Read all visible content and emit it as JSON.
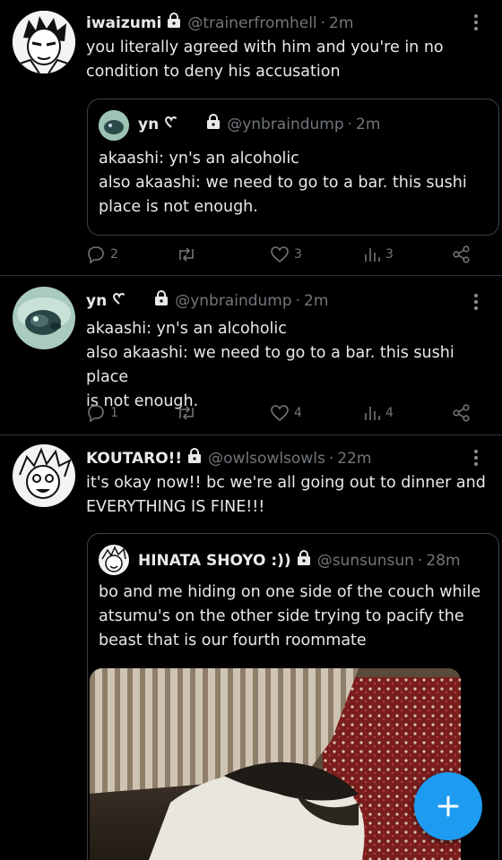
{
  "tweets": [
    {
      "name": "iwaizumi",
      "handle": "@trainerfromhell",
      "time": "2m",
      "text": "you literally agreed with him and you're in no\ncondition to deny his accusation",
      "quote": {
        "name": "yn",
        "handle": "@ynbraindump",
        "time": "2m",
        "text": "akaashi: yn's an alcoholic\nalso akaashi: we need to go to a bar. this sushi\nplace is not enough."
      },
      "actions": {
        "replies": "2",
        "likes": "3",
        "views": "3"
      }
    },
    {
      "name": "yn",
      "handle": "@ynbraindump",
      "time": "2m",
      "text": "akaashi: yn's an alcoholic\nalso akaashi: we need to go to a bar. this sushi place\nis not enough.",
      "actions": {
        "replies": "1",
        "likes": "4",
        "views": "4"
      }
    },
    {
      "name": "KOUTARO!!",
      "handle": "@owlsowlsowls",
      "time": "22m",
      "text": "it's okay now!! bc we're all going out to dinner and\nEVERYTHING IS FINE!!!",
      "quote": {
        "name": "HINATA SHOYO :))",
        "handle": "@sunsunsun",
        "time": "28m",
        "text": "bo and me hiding on one side of the couch while\natsumu's on the other side trying to pacify the\nbeast that is our fourth roommate"
      }
    }
  ],
  "separator": "·",
  "icons": [
    "lock-icon",
    "heart-glyph-icon",
    "reply-icon",
    "retweet-icon",
    "like-icon",
    "views-icon",
    "share-icon",
    "more-icon",
    "plus-icon"
  ],
  "colors": {
    "accent": "#1d9bf0",
    "muted": "#71767b",
    "background": "#000000"
  }
}
